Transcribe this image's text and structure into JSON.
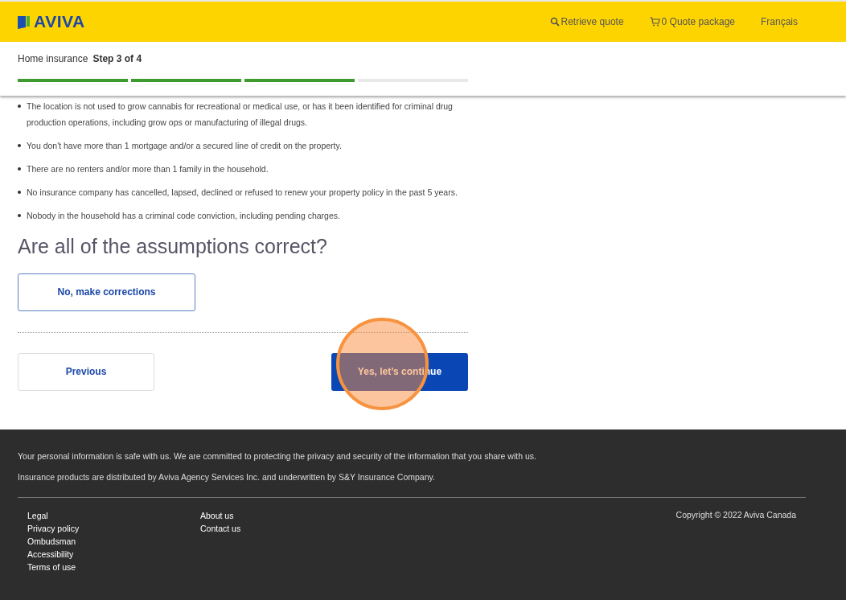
{
  "header": {
    "logo": "AVIVA",
    "links": [
      {
        "kind": "search",
        "label": "Retrieve quote"
      },
      {
        "kind": "cart",
        "label": "0 Quote package"
      },
      {
        "kind": "plain",
        "label": "Français"
      }
    ]
  },
  "progress": {
    "product": "Home insurance",
    "step": "Step 3 of 4",
    "segments": [
      {
        "complete": true
      },
      {
        "complete": true
      },
      {
        "complete": true
      },
      {
        "complete": false
      }
    ]
  },
  "assumptions": [
    "The location is not used to grow cannabis for recreational or medical use, or has it been identified for criminal drug production operations, including grow ops or manufacturing of illegal drugs.",
    "You don't have more than 1 mortgage and/or a secured line of credit on the property.",
    "There are no renters and/or more than 1 family in the household.",
    "No insurance company has cancelled, lapsed, declined or refused to renew your property policy in the past 5 years.",
    "Nobody in the household has a criminal code conviction, including pending charges."
  ],
  "question": "Are all of the assumptions correct?",
  "correction_button": "No, make corrections",
  "previous_button": "Previous",
  "continue_button": "Yes, let’s continue",
  "footer": {
    "notices": [
      "Your personal information is safe with us. We are committed to protecting the privacy and security of the information that you share with us.",
      "Insurance products are distributed by Aviva Agency Services Inc. and underwritten by S&Y Insurance Company."
    ],
    "columns": [
      [
        "Legal",
        "Privacy policy",
        "Ombudsman",
        "Accessibility",
        "Terms of use"
      ],
      [
        "About us",
        "Contact us"
      ]
    ],
    "copyright": "Copyright © 2022 Aviva Canada"
  }
}
